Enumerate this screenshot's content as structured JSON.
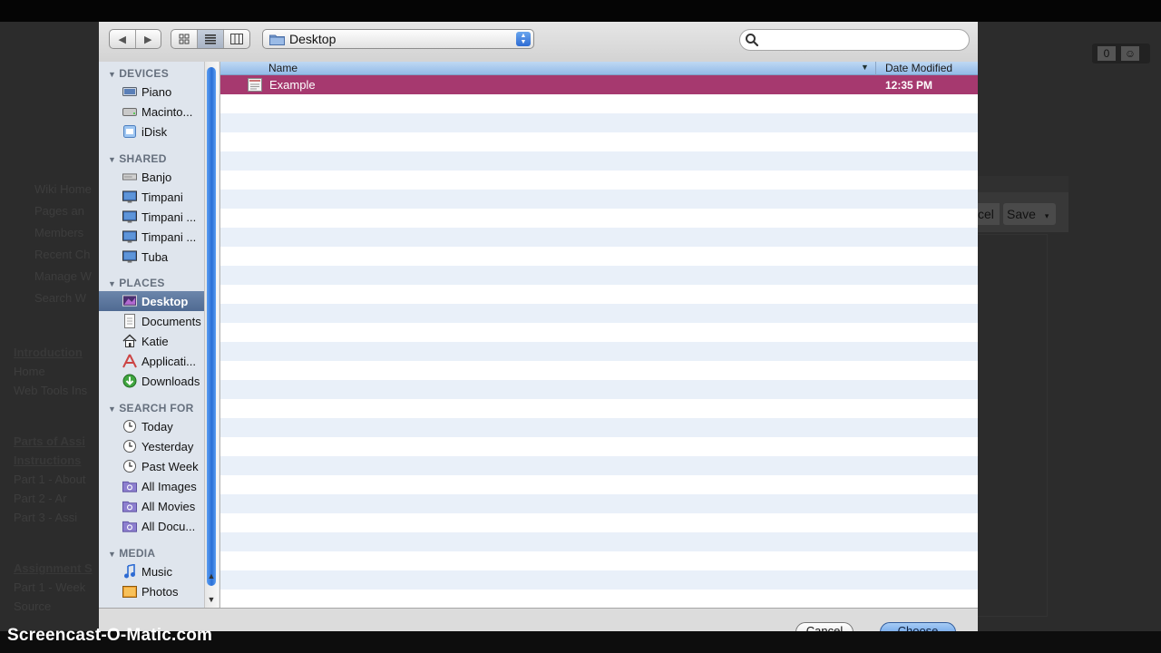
{
  "background_page": {
    "left_items": [
      "Wiki Home",
      "Pages an",
      "Members",
      "Recent Ch",
      "Manage W",
      "Search W"
    ],
    "section_intro": "Introduction",
    "intro_items": [
      "Home",
      "Web Tools Ins"
    ],
    "section_parts": "Parts of Assi",
    "section_parts_2": "Instructions",
    "parts_items": [
      "Part 1 - About",
      "Part 2 - Ar",
      "Part 3 - Assi"
    ],
    "section_assignment": "Assignment S",
    "assignment_items": [
      "Part 1 - Week",
      "Source"
    ],
    "right_cancel_label": "cel",
    "right_save_label": "Save",
    "right_counter": "0"
  },
  "dialog": {
    "path_label": "Desktop",
    "search": {
      "value": "",
      "placeholder": ""
    },
    "sidebar": {
      "sections": [
        {
          "title": "DEVICES",
          "items": [
            {
              "label": "Piano",
              "icon": "drive-icon"
            },
            {
              "label": "Macinto...",
              "icon": "hard-disk-icon"
            },
            {
              "label": "iDisk",
              "icon": "idisk-icon"
            }
          ]
        },
        {
          "title": "SHARED",
          "items": [
            {
              "label": "Banjo",
              "icon": "server-icon"
            },
            {
              "label": "Timpani",
              "icon": "monitor-icon"
            },
            {
              "label": "Timpani ...",
              "icon": "monitor-icon"
            },
            {
              "label": "Timpani ...",
              "icon": "monitor-icon"
            },
            {
              "label": "Tuba",
              "icon": "monitor-icon"
            }
          ]
        },
        {
          "title": "PLACES",
          "items": [
            {
              "label": "Desktop",
              "icon": "desktop-icon",
              "selected": true
            },
            {
              "label": "Documents",
              "icon": "documents-icon"
            },
            {
              "label": "Katie",
              "icon": "home-icon"
            },
            {
              "label": "Applicati...",
              "icon": "applications-icon"
            },
            {
              "label": "Downloads",
              "icon": "downloads-icon"
            }
          ]
        },
        {
          "title": "SEARCH FOR",
          "items": [
            {
              "label": "Today",
              "icon": "clock-icon"
            },
            {
              "label": "Yesterday",
              "icon": "clock-icon"
            },
            {
              "label": "Past Week",
              "icon": "clock-icon"
            },
            {
              "label": "All Images",
              "icon": "smart-folder-icon"
            },
            {
              "label": "All Movies",
              "icon": "smart-folder-icon"
            },
            {
              "label": "All Docu...",
              "icon": "smart-folder-icon"
            }
          ]
        },
        {
          "title": "MEDIA",
          "items": [
            {
              "label": "Music",
              "icon": "music-icon"
            },
            {
              "label": "Photos",
              "icon": "photos-icon"
            }
          ]
        }
      ]
    },
    "columns": {
      "name": "Name",
      "date": "Date Modified"
    },
    "files": [
      {
        "name": "Example",
        "date": "12:35 PM",
        "selected": true
      }
    ],
    "buttons": {
      "cancel": "Cancel",
      "choose": "Choose"
    }
  },
  "watermark": "Screencast-O-Matic.com",
  "colors": {
    "selection": "#a6396f",
    "sidebar_selection": "#5a7499",
    "accent_blue": "#3d7ee0"
  }
}
